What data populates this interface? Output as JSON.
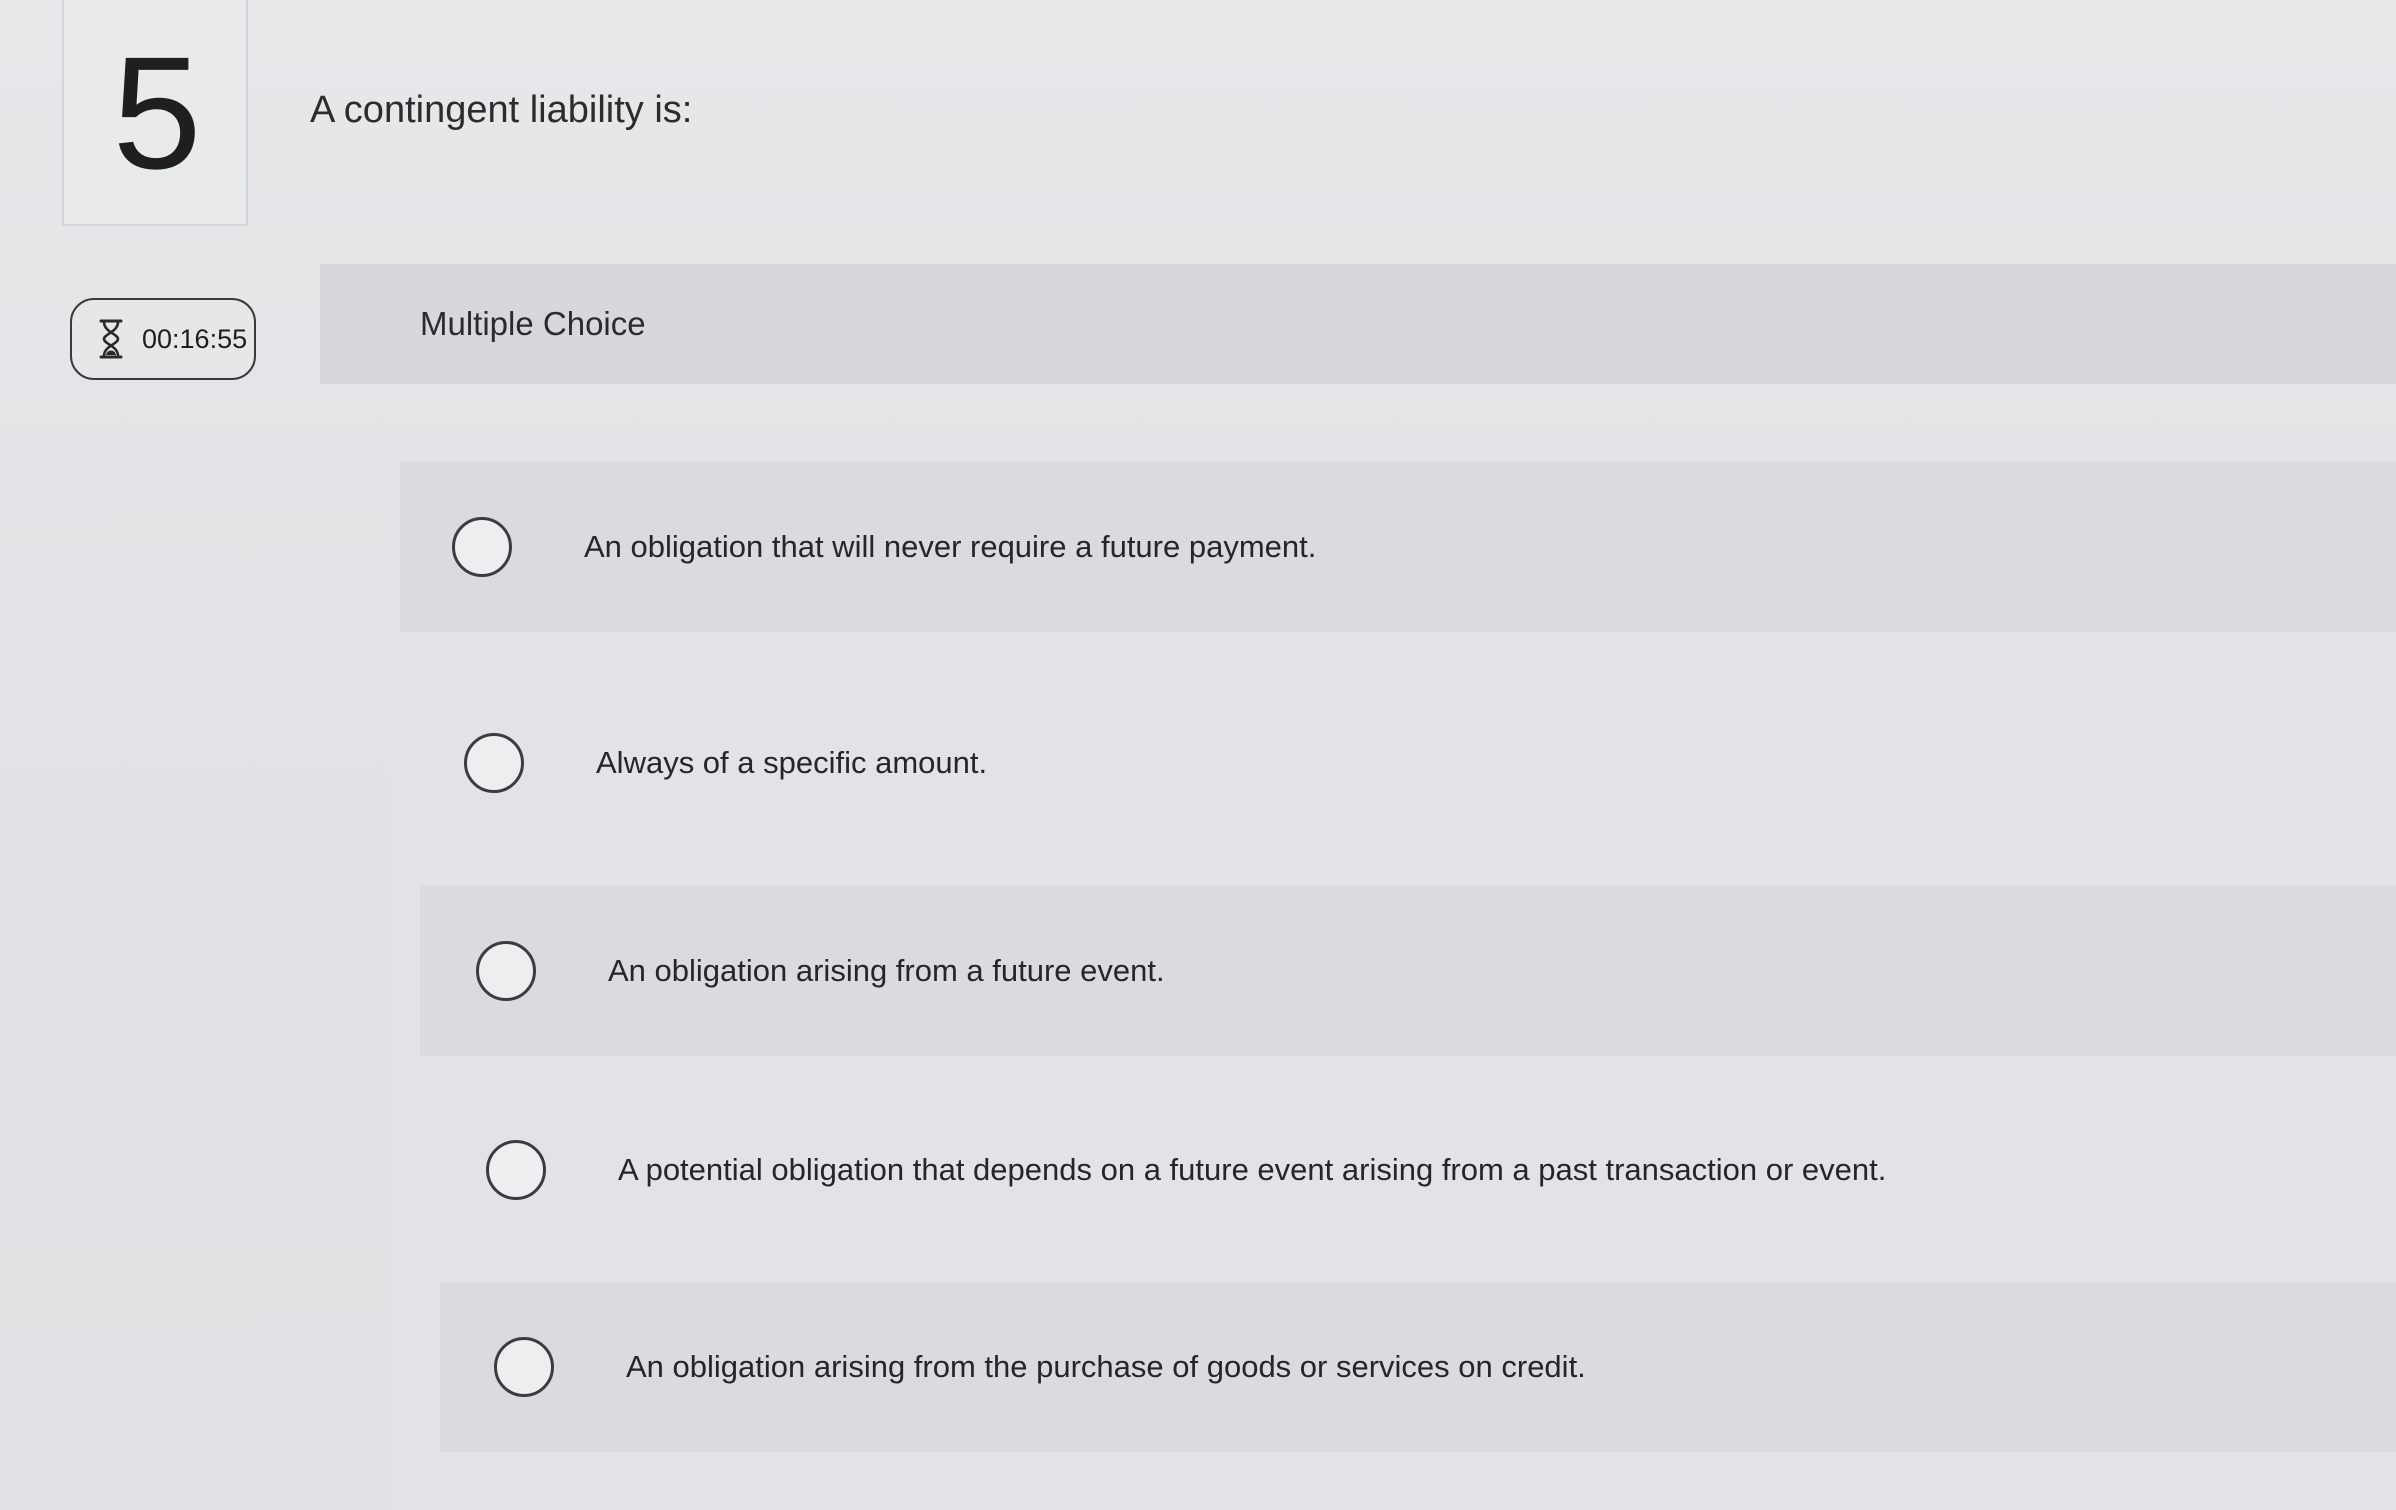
{
  "question": {
    "number": "5",
    "text": "A contingent liability is:"
  },
  "timer": {
    "icon": "hourglass-icon",
    "value": "00:16:55"
  },
  "question_type": "Multiple Choice",
  "choices": [
    {
      "label": "An obligation that will never require a future payment.",
      "selected": false
    },
    {
      "label": "Always of a specific amount.",
      "selected": false
    },
    {
      "label": "An obligation arising from a future event.",
      "selected": false
    },
    {
      "label": "A potential obligation that depends on a future event arising from a past transaction or event.",
      "selected": false
    },
    {
      "label": "An obligation arising from the purchase of goods or services on credit.",
      "selected": false
    }
  ]
}
